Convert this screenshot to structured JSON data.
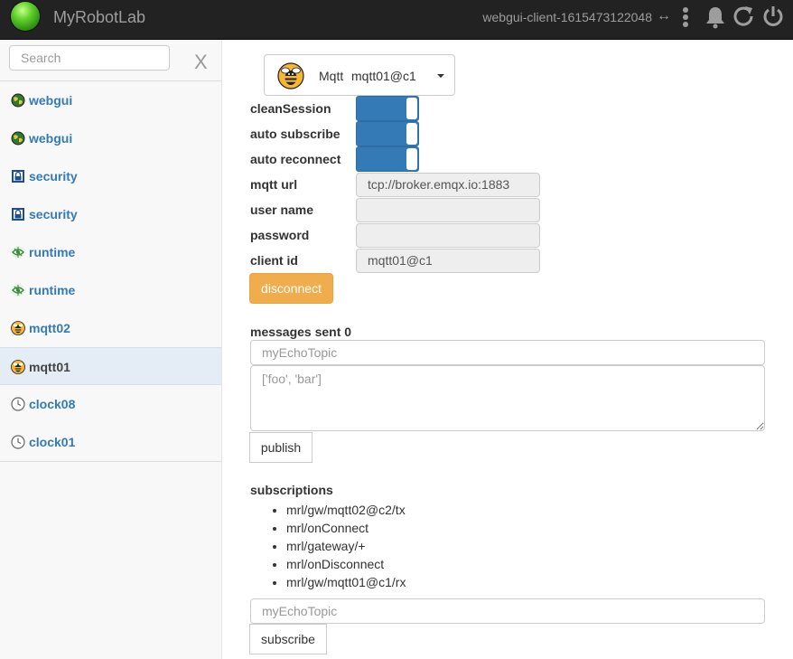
{
  "header": {
    "app_title": "MyRobotLab",
    "client_id": "webgui-client-1615473122048",
    "link_icon": "↔"
  },
  "sidebar": {
    "search_placeholder": "Search",
    "close_label": "X",
    "items": [
      {
        "label": "webgui",
        "icon": "globe-icon"
      },
      {
        "label": "webgui",
        "icon": "globe-icon"
      },
      {
        "label": "security",
        "icon": "lock-icon"
      },
      {
        "label": "security",
        "icon": "lock-icon"
      },
      {
        "label": "runtime",
        "icon": "runtime-icon"
      },
      {
        "label": "runtime",
        "icon": "runtime-icon"
      },
      {
        "label": "mqtt02",
        "icon": "bee-icon"
      },
      {
        "label": "mqtt01",
        "icon": "bee-icon",
        "active": true
      },
      {
        "label": "clock08",
        "icon": "clock-icon"
      },
      {
        "label": "clock01",
        "icon": "clock-icon"
      }
    ]
  },
  "service": {
    "type": "Mqtt",
    "name": "mqtt01@c1"
  },
  "form": {
    "clean_session_label": "cleanSession",
    "auto_subscribe_label": "auto subscribe",
    "auto_reconnect_label": "auto reconnect",
    "mqtt_url_label": "mqtt url",
    "mqtt_url_value": "tcp://broker.emqx.io:1883",
    "user_name_label": "user name",
    "user_name_value": "",
    "password_label": "password",
    "password_value": "",
    "client_id_label": "client id",
    "client_id_value": "mqtt01@c1",
    "toggles": {
      "clean_session": true,
      "auto_subscribe": true,
      "auto_reconnect": true
    },
    "disconnect_label": "disconnect"
  },
  "publish": {
    "messages_sent_label": "messages sent 0",
    "topic_placeholder": "myEchoTopic",
    "message_placeholder": "['foo', 'bar']",
    "publish_label": "publish"
  },
  "subscriptions": {
    "title": "subscriptions",
    "items": [
      "mrl/gw/mqtt02@c2/tx",
      "mrl/onConnect",
      "mrl/gateway/+",
      "mrl/onDisconnect",
      "mrl/gw/mqtt01@c1/rx"
    ],
    "topic_placeholder": "myEchoTopic",
    "subscribe_label": "subscribe"
  },
  "colors": {
    "accent": "#337ab7",
    "warning": "#f0ad4e",
    "topbar": "#222222"
  }
}
